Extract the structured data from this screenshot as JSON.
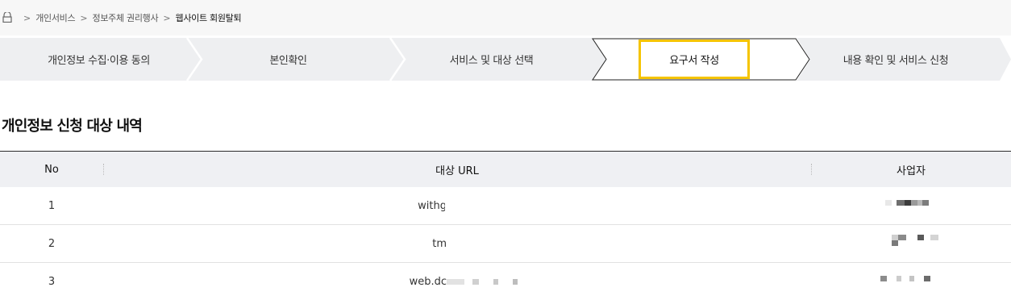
{
  "breadcrumb": {
    "items": [
      "개인서비스",
      "정보주체 권리행사",
      "웹사이트 회원탈퇴"
    ]
  },
  "steps": {
    "items": [
      "개인정보 수집·이용 동의",
      "본인확인",
      "서비스 및 대상 선택",
      "요구서 작성",
      "내용 확인 및 서비스 신청"
    ],
    "active_index": 3,
    "highlight_color": "#f5c400"
  },
  "section": {
    "title": "개인정보 신청 대상 내역"
  },
  "table": {
    "headers": [
      "No",
      "대상 URL",
      "사업자"
    ],
    "rows": [
      {
        "no": "1",
        "url": "withg"
      },
      {
        "no": "2",
        "url": "tm"
      },
      {
        "no": "3",
        "url": "web.dc"
      }
    ]
  },
  "colors": {
    "step_bg": "#eeeff1",
    "header_bg": "#eff0f3",
    "breadcrumb_bg": "#f7f7f7"
  }
}
